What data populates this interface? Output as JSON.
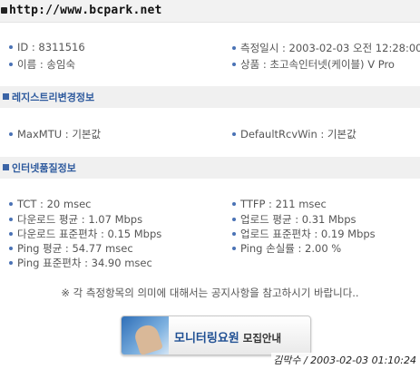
{
  "header": {
    "url": "http://www.bcpark.net"
  },
  "info": {
    "id": "ID : 8311516",
    "name": "이름 : 송임숙",
    "measure_time": "측정일시 : 2003-02-03 오전 12:28:00",
    "product": "상품 : 초고속인터넷(케이블) V Pro"
  },
  "registry": {
    "title": "레지스트리변경정보",
    "maxmtu": "MaxMTU : 기본값",
    "rcvwin": "DefaultRcvWin : 기본값"
  },
  "quality": {
    "title": "인터넷품질정보",
    "tct": "TCT : 20 msec",
    "ttfp": "TTFP : 211 msec",
    "down_avg": "다운로드 평균 : 1.07 Mbps",
    "up_avg": "업로드 평균 : 0.31 Mbps",
    "down_std": "다운로드 표준편차 : 0.15 Mbps",
    "up_std": "업로드 표준편차 : 0.19 Mbps",
    "ping_avg": "Ping 평균 : 54.77 msec",
    "ping_loss": "Ping 손실률 : 2.00 %",
    "ping_std": "Ping 표준편차 : 34.90 msec"
  },
  "notice": "※ 각 측정항목의 의미에 대해서는 공지사항을 참고하시기 바랍니다..",
  "banner": {
    "main": "모니터링요원",
    "sub": "모집안내"
  },
  "signature": "김막수 / 2003-02-03 01:10:24",
  "colors": {
    "accent": "#2f5b9e",
    "bullet": "#4a72b5"
  }
}
